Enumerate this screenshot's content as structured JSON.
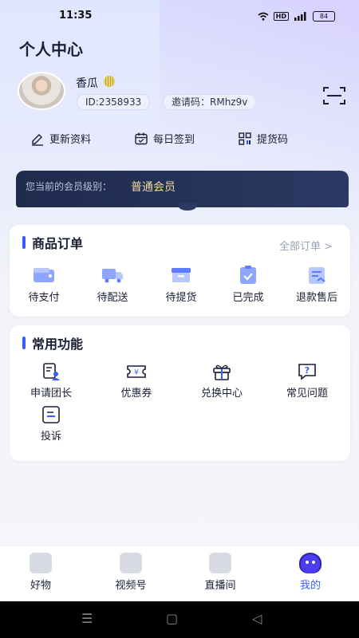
{
  "status_bar": {
    "time": "11:35",
    "battery": "84"
  },
  "header": {
    "title": "个人中心"
  },
  "profile": {
    "username": "香瓜",
    "id_text": "ID:2358933",
    "invite_text": "邀请码：RMhz9v"
  },
  "quick_actions": [
    {
      "label": "更新资料",
      "icon": "edit-icon"
    },
    {
      "label": "每日签到",
      "icon": "calendar-icon"
    },
    {
      "label": "提货码",
      "icon": "qrcode-icon"
    }
  ],
  "membership": {
    "label": "您当前的会员级别：",
    "level": "普通会员"
  },
  "orders": {
    "title": "商品订单",
    "all_link": "全部订单 >",
    "items": [
      {
        "label": "待支付",
        "icon": "wallet-icon"
      },
      {
        "label": "待配送",
        "icon": "truck-icon"
      },
      {
        "label": "待提货",
        "icon": "box-icon"
      },
      {
        "label": "已完成",
        "icon": "check-clipboard-icon"
      },
      {
        "label": "退款售后",
        "icon": "refund-icon"
      }
    ]
  },
  "functions": {
    "title": "常用功能",
    "items": [
      {
        "label": "申请团长",
        "icon": "apply-leader-icon"
      },
      {
        "label": "优惠券",
        "icon": "coupon-icon"
      },
      {
        "label": "兑换中心",
        "icon": "gift-icon"
      },
      {
        "label": "常见问题",
        "icon": "question-icon"
      },
      {
        "label": "投诉",
        "icon": "complaint-icon"
      }
    ]
  },
  "tabbar": {
    "tabs": [
      {
        "label": "好物",
        "icon": "shopping-bag-icon",
        "active": false
      },
      {
        "label": "视频号",
        "icon": "tv-icon",
        "active": false
      },
      {
        "label": "直播间",
        "icon": "camera-icon",
        "active": false
      },
      {
        "label": "我的",
        "icon": "robot-icon",
        "active": true
      }
    ]
  },
  "colors": {
    "accent": "#3a5cff",
    "member_bg": "#1f2b4d",
    "member_gold": "#f1d7a3"
  }
}
